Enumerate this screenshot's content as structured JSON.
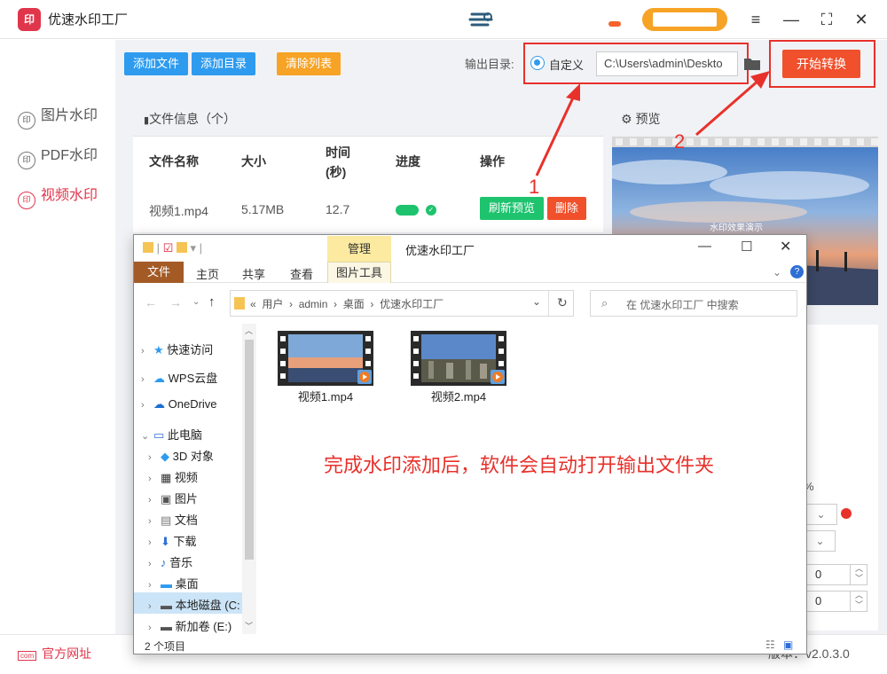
{
  "app": {
    "title": "优速水印工厂",
    "logo_text": "印"
  },
  "nav": {
    "items": [
      {
        "label": "图片水印",
        "icon_text": "印"
      },
      {
        "label": "PDF水印",
        "icon_text": "印"
      },
      {
        "label": "视频水印",
        "icon_text": "印"
      }
    ]
  },
  "toolbar": {
    "add_file": "添加文件",
    "add_dir": "添加目录",
    "clear_list": "清除列表",
    "output_label": "输出目录:",
    "custom_label": "自定义",
    "output_path": "C:\\Users\\admin\\Deskto",
    "start": "开始转换"
  },
  "file_panel": {
    "title": "文件信息（个）",
    "headers": {
      "name": "文件名称",
      "size": "大小",
      "time": "时间",
      "time_unit": "(秒)",
      "progress": "进度",
      "action": "操作"
    },
    "rows": [
      {
        "name": "视频1.mp4",
        "size": "5.17MB",
        "time": "12.7",
        "refresh": "刷新预览",
        "delete": "删除"
      }
    ]
  },
  "preview": {
    "title": "预览",
    "watermark": "水印效果演示"
  },
  "settings": {
    "percent": "%",
    "num1": "0",
    "num2": "0"
  },
  "explorer": {
    "manage_tab": "管理",
    "title": "优速水印工厂",
    "tabs": {
      "file": "文件",
      "home": "主页",
      "share": "共享",
      "view": "查看",
      "tools": "图片工具"
    },
    "breadcrumb": [
      "用户",
      "admin",
      "桌面",
      "优速水印工厂"
    ],
    "search_placeholder": "在 优速水印工厂 中搜索",
    "tree": [
      {
        "label": "快速访问",
        "icon": "star-icon",
        "level": 0
      },
      {
        "label": "WPS云盘",
        "icon": "cloud-icon",
        "level": 0
      },
      {
        "label": "OneDrive",
        "icon": "onedrive-icon",
        "level": 0
      },
      {
        "label": "此电脑",
        "icon": "pc-icon",
        "level": 0
      },
      {
        "label": "3D 对象",
        "icon": "cube-icon",
        "level": 1
      },
      {
        "label": "视频",
        "icon": "film-icon",
        "level": 1
      },
      {
        "label": "图片",
        "icon": "picture-icon",
        "level": 1
      },
      {
        "label": "文档",
        "icon": "document-icon",
        "level": 1
      },
      {
        "label": "下载",
        "icon": "download-icon",
        "level": 1
      },
      {
        "label": "音乐",
        "icon": "music-icon",
        "level": 1
      },
      {
        "label": "桌面",
        "icon": "desktop-icon",
        "level": 1
      },
      {
        "label": "本地磁盘 (C:",
        "icon": "drive-icon",
        "level": 1
      },
      {
        "label": "新加卷 (E:)",
        "icon": "drive-icon",
        "level": 1
      }
    ],
    "files": [
      {
        "name": "视频1.mp4"
      },
      {
        "name": "视频2.mp4"
      }
    ],
    "status": "2 个项目"
  },
  "overlay_message": "完成水印添加后，软件会自动打开输出文件夹",
  "annotations": {
    "step1": "1",
    "step2": "2"
  },
  "footer": {
    "site": "官方网址",
    "version": "版本：v2.0.3.0"
  },
  "colors": {
    "brand": "#e0364b",
    "blue": "#2e9bef",
    "orange": "#f7a325",
    "red": "#f0502b",
    "green": "#1ec36e"
  }
}
